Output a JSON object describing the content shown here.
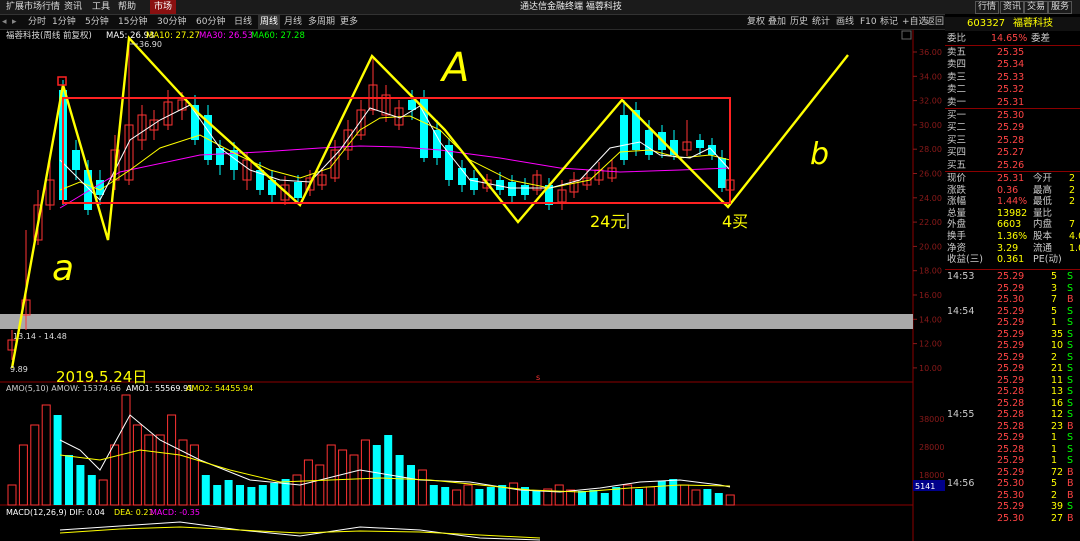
{
  "window": {
    "menu": [
      "扩展市场行情",
      "资讯",
      "工具",
      "帮助"
    ],
    "market_tab": "市场",
    "title": "通达信金融终端  福蓉科技",
    "window_buttons": [
      "行情",
      "资讯",
      "交易",
      "服务"
    ]
  },
  "toolbar": {
    "periods": [
      "分时",
      "1分钟",
      "5分钟",
      "15分钟",
      "30分钟",
      "60分钟",
      "日线",
      "周线",
      "月线",
      "多周期",
      "更多"
    ],
    "active_period": "周线",
    "right_tools": [
      "复权",
      "叠加",
      "历史",
      "统计",
      "画线",
      "F10",
      "标记",
      "+自选",
      "返回"
    ]
  },
  "chart": {
    "title": "福蓉科技(周线 前复权)",
    "ma_legend": [
      {
        "label": "MA5: 26.93",
        "color": "#ffffff"
      },
      {
        "label": "MA10: 27.27",
        "color": "#ffff00"
      },
      {
        "label": "MA30: 26.53",
        "color": "#ff00ff"
      },
      {
        "label": "MA60: 27.28",
        "color": "#00ff00"
      }
    ],
    "y_ticks": [
      "36.00",
      "34.00",
      "32.00",
      "30.00",
      "28.00",
      "26.00",
      "24.00",
      "22.00",
      "20.00",
      "18.00",
      "16.00",
      "14.00",
      "12.00",
      "10.00"
    ],
    "high_label": "36.90",
    "low_label": "9.89",
    "volume_zone_label": "13.14 - 14.48",
    "annotations": {
      "A": "A",
      "a": "a",
      "b": "b",
      "yuan24": "24元",
      "buy4": "4买",
      "date": "2019.5.24日",
      "marker_s": "s"
    },
    "amo_legend": [
      {
        "label": "AMO(5,10) AMOW: 15374.66",
        "color": "#cccccc"
      },
      {
        "label": "AMO1: 55569.91",
        "color": "#ffffff"
      },
      {
        "label": "AMO2: 54455.94",
        "color": "#ffff00"
      }
    ],
    "amo_ticks": [
      "38000",
      "28000",
      "18000"
    ],
    "amo_last": "5141",
    "macd_legend": [
      {
        "label": "MACD(12,26,9) DIF: 0.04",
        "color": "#ffffff"
      },
      {
        "label": "DEA: 0.21",
        "color": "#ffff00"
      },
      {
        "label": "MACD: -0.35",
        "color": "#ff00ff"
      }
    ]
  },
  "quote": {
    "code": "603327",
    "name": "福蓉科技",
    "weibi_label": "委比",
    "weibi": "14.65%",
    "weicha_label": "委差",
    "asks": [
      {
        "label": "卖五",
        "price": "25.35"
      },
      {
        "label": "卖四",
        "price": "25.34"
      },
      {
        "label": "卖三",
        "price": "25.33"
      },
      {
        "label": "卖二",
        "price": "25.32"
      },
      {
        "label": "卖一",
        "price": "25.31"
      }
    ],
    "bids": [
      {
        "label": "买一",
        "price": "25.30"
      },
      {
        "label": "买二",
        "price": "25.29"
      },
      {
        "label": "买三",
        "price": "25.28"
      },
      {
        "label": "买四",
        "price": "25.27"
      },
      {
        "label": "买五",
        "price": "25.26"
      }
    ],
    "stats": [
      {
        "l1": "现价",
        "v1": "25.31",
        "l2": "今开",
        "v2": "2"
      },
      {
        "l1": "涨跌",
        "v1": "0.36",
        "l2": "最高",
        "v2": "2"
      },
      {
        "l1": "涨幅",
        "v1": "1.44%",
        "l2": "最低",
        "v2": "2"
      },
      {
        "l1": "总量",
        "v1": "13982",
        "l2": "量比",
        "v2": ""
      },
      {
        "l1": "外盘",
        "v1": "6603",
        "l2": "内盘",
        "v2": "7"
      },
      {
        "l1": "换手",
        "v1": "1.36%",
        "l2": "股本",
        "v2": "4.0"
      },
      {
        "l1": "净资",
        "v1": "3.29",
        "l2": "流通",
        "v2": "1.0"
      },
      {
        "l1": "收益(三)",
        "v1": "0.361",
        "l2": "PE(动)",
        "v2": ""
      }
    ],
    "ticks": [
      {
        "time": "14:53",
        "price": "25.29",
        "vol": "5",
        "side": "S"
      },
      {
        "time": "",
        "price": "25.29",
        "vol": "3",
        "side": "S"
      },
      {
        "time": "",
        "price": "25.30",
        "vol": "7",
        "side": "B"
      },
      {
        "time": "14:54",
        "price": "25.29",
        "vol": "5",
        "side": "S"
      },
      {
        "time": "",
        "price": "25.29",
        "vol": "1",
        "side": "S"
      },
      {
        "time": "",
        "price": "25.29",
        "vol": "35",
        "side": "S"
      },
      {
        "time": "",
        "price": "25.29",
        "vol": "10",
        "side": "S"
      },
      {
        "time": "",
        "price": "25.29",
        "vol": "2",
        "side": "S"
      },
      {
        "time": "",
        "price": "25.29",
        "vol": "21",
        "side": "S"
      },
      {
        "time": "",
        "price": "25.29",
        "vol": "11",
        "side": "S"
      },
      {
        "time": "",
        "price": "25.28",
        "vol": "13",
        "side": "S"
      },
      {
        "time": "",
        "price": "25.28",
        "vol": "16",
        "side": "S"
      },
      {
        "time": "14:55",
        "price": "25.28",
        "vol": "12",
        "side": "S"
      },
      {
        "time": "",
        "price": "25.28",
        "vol": "23",
        "side": "B"
      },
      {
        "time": "",
        "price": "25.29",
        "vol": "1",
        "side": "S"
      },
      {
        "time": "",
        "price": "25.28",
        "vol": "1",
        "side": "S"
      },
      {
        "time": "",
        "price": "25.29",
        "vol": "1",
        "side": "S"
      },
      {
        "time": "",
        "price": "25.29",
        "vol": "72",
        "side": "B"
      },
      {
        "time": "14:56",
        "price": "25.30",
        "vol": "5",
        "side": "B"
      },
      {
        "time": "",
        "price": "25.30",
        "vol": "2",
        "side": "B"
      },
      {
        "time": "",
        "price": "25.29",
        "vol": "39",
        "side": "S"
      },
      {
        "time": "",
        "price": "25.30",
        "vol": "27",
        "side": "B"
      }
    ]
  }
}
